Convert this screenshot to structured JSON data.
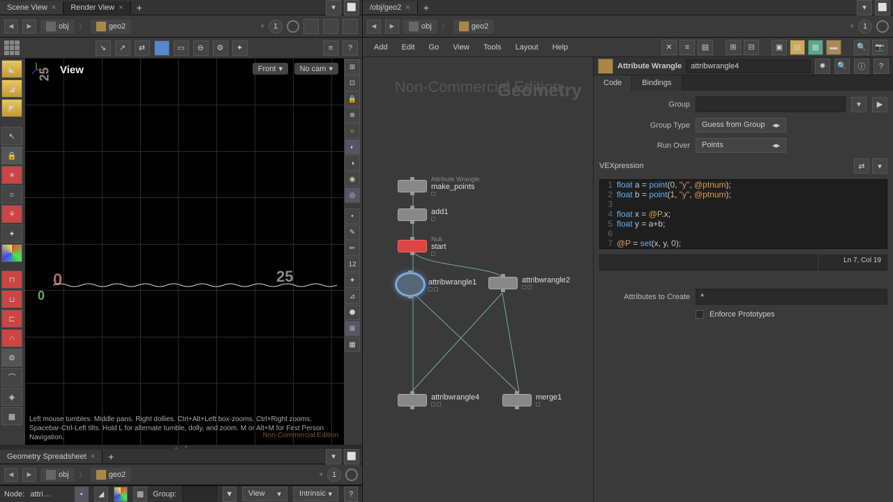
{
  "left": {
    "tabs": [
      "Scene View",
      "Render View"
    ],
    "path": {
      "root": "obj",
      "current": "geo2",
      "num": "1"
    },
    "viewport": {
      "title": "View",
      "front": "Front",
      "cam": "No cam",
      "axis_top": "25",
      "axis_zero_y": "0",
      "axis_zero_x": "0",
      "axis_25": "25",
      "hint": "Left mouse tumbles. Middle pans. Right dollies. Ctrl+Alt+Left box-zooms. Ctrl+Right zooms. Spacebar-Ctrl-Left tilts. Hold L for alternate tumble, dolly, and zoom. M or Alt+M for First Person Navigation.",
      "nce": "Non-Commercial Edition"
    },
    "spreadsheet": {
      "tab": "Geometry Spreadsheet",
      "node_label": "Node:",
      "node_value": "attri…",
      "group_label": "Group:",
      "view": "View",
      "intrinsic": "Intrinsic"
    }
  },
  "right": {
    "tabs": [
      "/obj/geo2"
    ],
    "path": {
      "root": "obj",
      "current": "geo2",
      "num": "1"
    },
    "menu": [
      "Add",
      "Edit",
      "Go",
      "View",
      "Tools",
      "Layout",
      "Help"
    ],
    "nce_bg": "Non-Commercial Edition",
    "geo_bg": "Geometry",
    "nodes": {
      "make_points": {
        "type": "Attribute Wrangle",
        "name": "make_points"
      },
      "add1": "add1",
      "start": {
        "type": "Null",
        "name": "start"
      },
      "aw1": "attribwrangle1",
      "aw2": "attribwrangle2",
      "aw4": "attribwrangle4",
      "merge1": "merge1"
    }
  },
  "params": {
    "title": "Attribute Wrangle",
    "name": "attribwrangle4",
    "tabs": [
      "Code",
      "Bindings"
    ],
    "group_label": "Group",
    "group_type_label": "Group Type",
    "group_type": "Guess from Group",
    "run_over_label": "Run Over",
    "run_over": "Points",
    "vex_label": "VEXpression",
    "status": "Ln 7, Col 19",
    "attrs_label": "Attributes to Create",
    "attrs_value": "*",
    "enforce": "Enforce Prototypes",
    "code": [
      {
        "n": "1",
        "html": "<span class='kw'>float</span> <span>a</span> = <span class='fn'>point</span>(<span class='num'>0</span>, <span class='str'>\"y\"</span>, <span class='var'>@ptnum</span>);"
      },
      {
        "n": "2",
        "html": "<span class='kw'>float</span> <span>b</span> = <span class='fn'>point</span>(<span class='num'>1</span>, <span class='str'>\"y\"</span>, <span class='var'>@ptnum</span>);"
      },
      {
        "n": "3",
        "html": ""
      },
      {
        "n": "4",
        "html": "<span class='kw'>float</span> <span>x</span> = <span class='var'>@P</span>.x;"
      },
      {
        "n": "5",
        "html": "<span class='kw'>float</span> <span>y</span> = a+b;"
      },
      {
        "n": "6",
        "html": ""
      },
      {
        "n": "7",
        "html": "<span class='var'>@P</span> = <span class='fn'>set</span>(x, y, <span class='num'>0</span>);"
      }
    ]
  }
}
